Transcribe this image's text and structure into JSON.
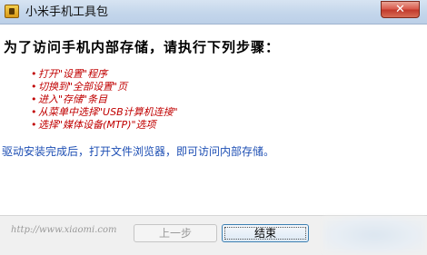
{
  "window": {
    "title": "小米手机工具包",
    "close_label": "✕"
  },
  "content": {
    "heading": "为了访问手机内部存储，请执行下列步骤：",
    "steps": [
      "打开\"设置\"程序",
      "切换到\"全部设置\"页",
      "进入\"存储\"条目",
      "从菜单中选择\"USB计算机连接\"",
      "选择\"媒体设备(MTP)\"选项"
    ],
    "note": "驱动安装完成后，打开文件浏览器，即可访问内部存储。"
  },
  "footer": {
    "url": "http://www.xiaomi.com",
    "prev_label": "上一步",
    "finish_label": "结束"
  },
  "colors": {
    "step_text": "#c00000",
    "note_text": "#1e4fb4",
    "close_button": "#c0392b"
  },
  "icons": {
    "app": "toolbox-icon",
    "close": "close-icon"
  }
}
